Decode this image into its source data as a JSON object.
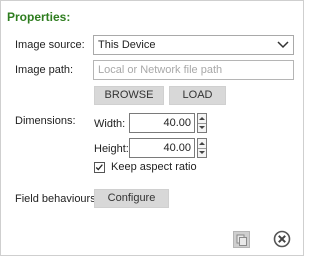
{
  "panel": {
    "title": "Properties:"
  },
  "image_source": {
    "label": "Image source:",
    "value": "This Device"
  },
  "image_path": {
    "label": "Image path:",
    "placeholder": "Local or Network file path",
    "value": ""
  },
  "buttons": {
    "browse": "BROWSE",
    "load": "LOAD",
    "configure": "Configure"
  },
  "dimensions": {
    "label": "Dimensions:",
    "width_label": "Width:",
    "width_value": "40.00",
    "height_label": "Height:",
    "height_value": "40.00",
    "keep_aspect_label": "Keep aspect ratio",
    "keep_aspect_checked": true
  },
  "field_behaviours": {
    "label": "Field behaviours:"
  },
  "icons": {
    "select_chevron": "chevron-down-icon",
    "copy": "copy-icon",
    "close": "close-icon"
  },
  "colors": {
    "title": "#2e7d1f",
    "button_bg": "#d8d8d8"
  }
}
